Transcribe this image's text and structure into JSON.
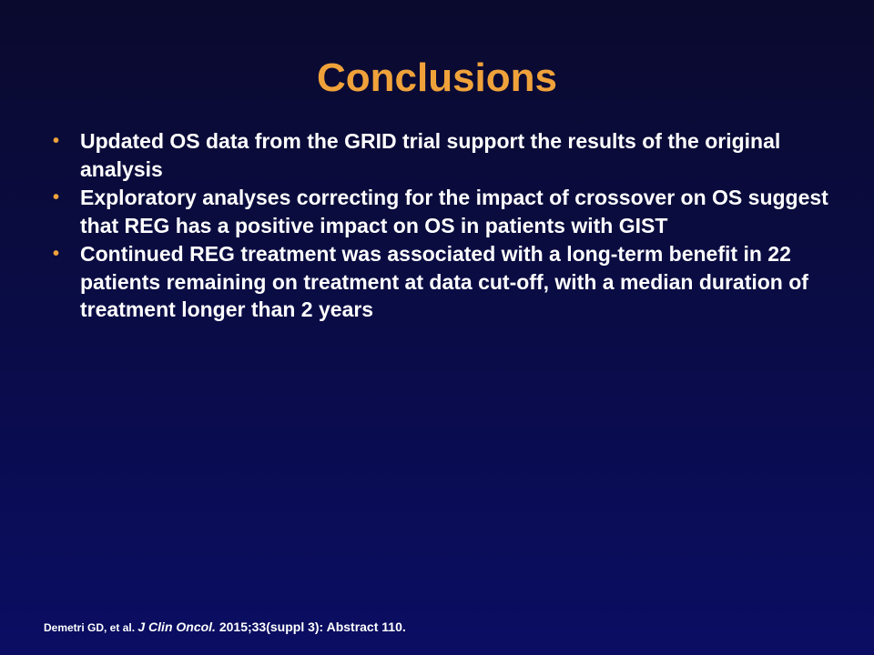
{
  "slide": {
    "title": "Conclusions",
    "bullets": [
      {
        "marker": "•",
        "text": "Updated OS data from the GRID trial support the results of the original analysis"
      },
      {
        "marker": "•",
        "text": "Exploratory analyses correcting for the impact of crossover on OS suggest that REG has a positive impact on OS in patients with GIST"
      },
      {
        "marker": "•",
        "text": "Continued REG treatment was associated with a long-term benefit in 22 patients remaining on treatment at data cut-off, with a median duration of treatment longer than 2 years"
      }
    ],
    "citation": {
      "authors": "Demetri GD, et al. ",
      "journal": "J Clin Oncol.",
      "details": " 2015;33(suppl 3): Abstract 110."
    }
  },
  "colors": {
    "title": "#f0a23a",
    "bullet_marker": "#f0a23a",
    "text": "#ffffff",
    "background_top": "#0a0a2e",
    "background_bottom": "#0a0d63"
  }
}
